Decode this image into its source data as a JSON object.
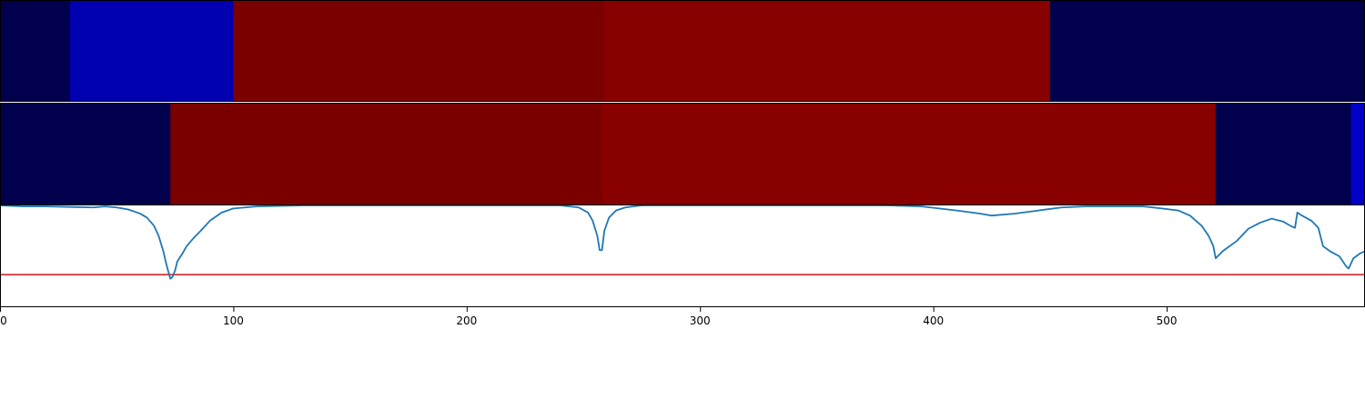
{
  "chart_data": {
    "type": "segmentation-line",
    "x_range": [
      0,
      585
    ],
    "x_ticks": [
      {
        "value": 0,
        "label": "0"
      },
      {
        "value": 100,
        "label": "100"
      },
      {
        "value": 200,
        "label": "200"
      },
      {
        "value": 300,
        "label": "300"
      },
      {
        "value": 400,
        "label": "400"
      },
      {
        "value": 500,
        "label": "500"
      }
    ],
    "tracks": [
      {
        "segments": [
          {
            "start": 0,
            "end": 30,
            "color": "#00004c"
          },
          {
            "start": 30,
            "end": 100,
            "color": "#0000b0"
          },
          {
            "start": 100,
            "end": 259,
            "color": "#7a0000"
          },
          {
            "start": 259,
            "end": 450,
            "color": "#880000"
          },
          {
            "start": 450,
            "end": 585,
            "color": "#00004c"
          }
        ]
      },
      {
        "segments": [
          {
            "start": 0,
            "end": 73,
            "color": "#00004c"
          },
          {
            "start": 73,
            "end": 258,
            "color": "#7a0000"
          },
          {
            "start": 258,
            "end": 521,
            "color": "#880000"
          },
          {
            "start": 521,
            "end": 579,
            "color": "#00004c"
          },
          {
            "start": 579,
            "end": 585,
            "color": "#0000c8"
          }
        ]
      }
    ],
    "line_panel": {
      "y_range": [
        0,
        1
      ],
      "threshold": 0.32,
      "threshold_color": "#d62728",
      "line_color": "#1f77b4",
      "points": [
        [
          0,
          1.0
        ],
        [
          10,
          0.99
        ],
        [
          20,
          0.99
        ],
        [
          30,
          0.985
        ],
        [
          40,
          0.98
        ],
        [
          45,
          0.99
        ],
        [
          50,
          0.98
        ],
        [
          55,
          0.96
        ],
        [
          60,
          0.92
        ],
        [
          63,
          0.88
        ],
        [
          66,
          0.8
        ],
        [
          68,
          0.7
        ],
        [
          70,
          0.55
        ],
        [
          71,
          0.45
        ],
        [
          72,
          0.36
        ],
        [
          73,
          0.28
        ],
        [
          74,
          0.3
        ],
        [
          75,
          0.36
        ],
        [
          76,
          0.45
        ],
        [
          78,
          0.52
        ],
        [
          80,
          0.6
        ],
        [
          83,
          0.68
        ],
        [
          86,
          0.75
        ],
        [
          90,
          0.85
        ],
        [
          95,
          0.93
        ],
        [
          100,
          0.97
        ],
        [
          110,
          0.99
        ],
        [
          130,
          1.0
        ],
        [
          200,
          1.0
        ],
        [
          240,
          1.0
        ],
        [
          248,
          0.98
        ],
        [
          252,
          0.93
        ],
        [
          254,
          0.85
        ],
        [
          256,
          0.7
        ],
        [
          257,
          0.56
        ],
        [
          258,
          0.56
        ],
        [
          259,
          0.75
        ],
        [
          261,
          0.88
        ],
        [
          264,
          0.95
        ],
        [
          268,
          0.98
        ],
        [
          275,
          1.0
        ],
        [
          300,
          1.0
        ],
        [
          340,
          1.0
        ],
        [
          380,
          1.0
        ],
        [
          395,
          0.99
        ],
        [
          410,
          0.95
        ],
        [
          420,
          0.92
        ],
        [
          425,
          0.9
        ],
        [
          435,
          0.92
        ],
        [
          445,
          0.95
        ],
        [
          455,
          0.98
        ],
        [
          465,
          0.99
        ],
        [
          480,
          0.99
        ],
        [
          490,
          0.99
        ],
        [
          498,
          0.97
        ],
        [
          505,
          0.95
        ],
        [
          510,
          0.9
        ],
        [
          515,
          0.8
        ],
        [
          518,
          0.7
        ],
        [
          520,
          0.6
        ],
        [
          521,
          0.48
        ],
        [
          524,
          0.55
        ],
        [
          530,
          0.65
        ],
        [
          535,
          0.77
        ],
        [
          540,
          0.83
        ],
        [
          545,
          0.87
        ],
        [
          550,
          0.84
        ],
        [
          553,
          0.8
        ],
        [
          555,
          0.78
        ],
        [
          556,
          0.93
        ],
        [
          558,
          0.9
        ],
        [
          562,
          0.85
        ],
        [
          565,
          0.78
        ],
        [
          567,
          0.6
        ],
        [
          570,
          0.55
        ],
        [
          574,
          0.5
        ],
        [
          577,
          0.4
        ],
        [
          578,
          0.38
        ],
        [
          580,
          0.48
        ],
        [
          583,
          0.53
        ],
        [
          585,
          0.55
        ]
      ]
    }
  }
}
